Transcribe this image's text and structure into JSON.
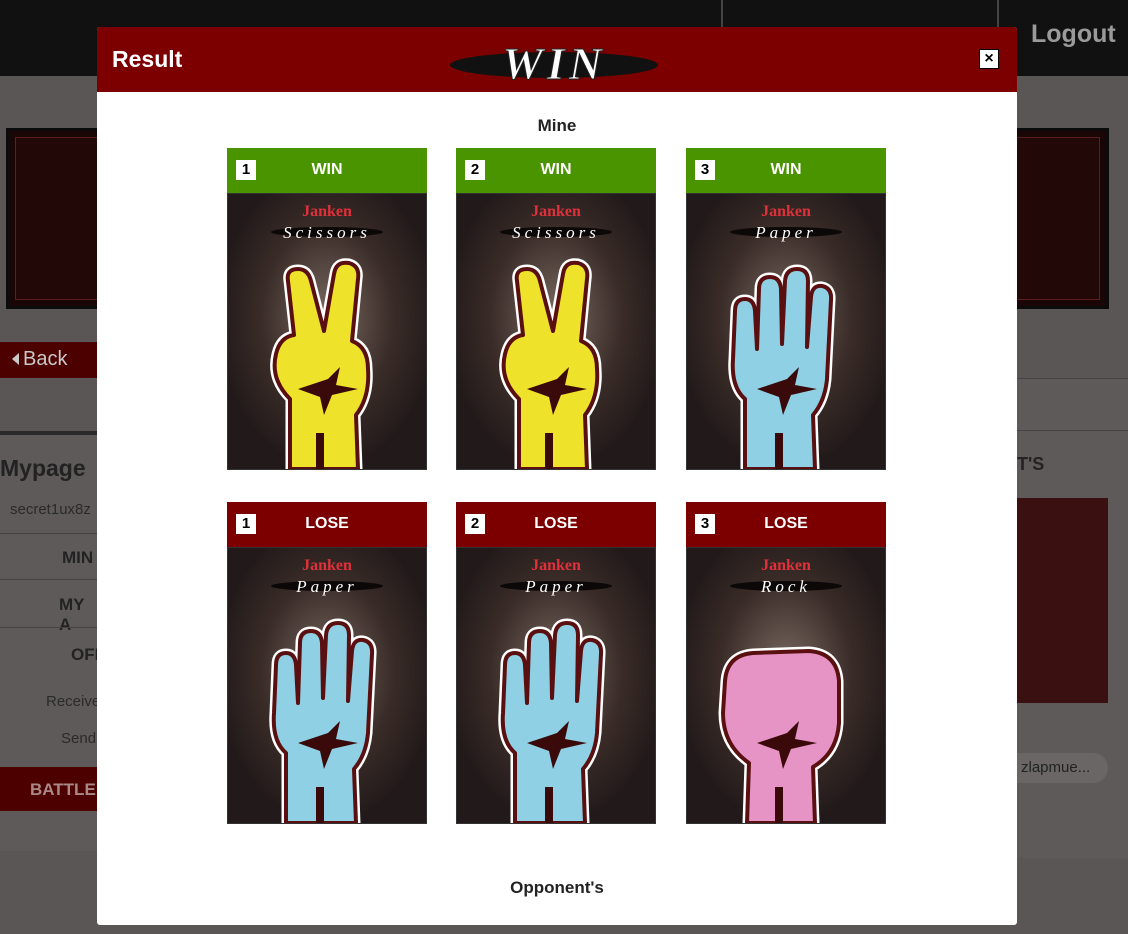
{
  "background": {
    "logout_label": "Logout",
    "back_label": "Back",
    "mypage_title": "Mypage",
    "user_id": "secret1ux8z",
    "menu": [
      "MIN",
      "MY A",
      "OFI"
    ],
    "sub_links": [
      "Receive",
      "Send"
    ],
    "battle_label": "BATTLE",
    "right_heading": "T'S",
    "right_pill": "zlapmue..."
  },
  "modal": {
    "title": "Result",
    "outcome": "WIN",
    "close_label": "×",
    "mine_label": "Mine",
    "opponent_label": "Opponent's"
  },
  "mine_cards": [
    {
      "number": "1",
      "result": "WIN",
      "brand": "Janken",
      "hand": "Scissors",
      "hand_label": "Scissors",
      "color": "#efe22b"
    },
    {
      "number": "2",
      "result": "WIN",
      "brand": "Janken",
      "hand": "Scissors",
      "hand_label": "Scissors",
      "color": "#efe22b"
    },
    {
      "number": "3",
      "result": "WIN",
      "brand": "Janken",
      "hand": "Paper",
      "hand_label": "Paper",
      "color": "#8fd0e4"
    }
  ],
  "opponent_cards": [
    {
      "number": "1",
      "result": "LOSE",
      "brand": "Janken",
      "hand": "Paper",
      "hand_label": "Paper",
      "color": "#8fd0e4"
    },
    {
      "number": "2",
      "result": "LOSE",
      "brand": "Janken",
      "hand": "Paper",
      "hand_label": "Paper",
      "color": "#8fd0e4"
    },
    {
      "number": "3",
      "result": "LOSE",
      "brand": "Janken",
      "hand": "Rock",
      "hand_label": "Rock",
      "color": "#e693c6"
    }
  ],
  "colors": {
    "header": "#7d0000",
    "win": "#4a9400",
    "lose": "#7d0000"
  }
}
